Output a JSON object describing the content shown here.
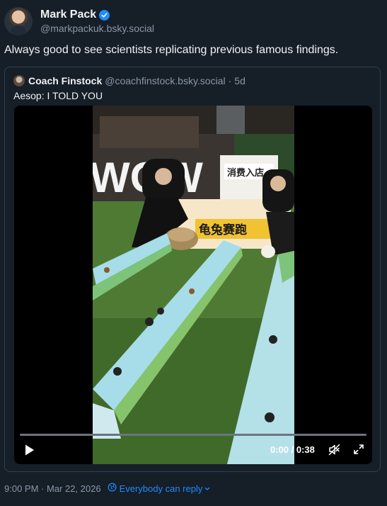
{
  "post": {
    "author_name": "Mark Pack",
    "author_handle": "@markpackuk.bsky.social",
    "text": "Always good to see scientists replicating previous famous findings.",
    "timestamp": "9:00 PM · Mar 22, 2026",
    "reply_setting": "Everybody can reply"
  },
  "quote": {
    "author_name": "Coach Finstock",
    "author_handle": "@coachfinstock.bsky.social",
    "separator": "·",
    "age": "5d",
    "text": "Aesop: I TOLD YOU"
  },
  "video": {
    "time_display": "0:00 / 0:38",
    "progress": 0,
    "scene_sign_text": "消费入店",
    "scene_banner_text": "龟兔赛跑",
    "scene_big_letters": "WOW"
  },
  "colors": {
    "background": "#161e27",
    "accent": "#208bfe",
    "muted_text": "#8a98a8",
    "border": "#2e4052"
  },
  "icons": {
    "verified": "verified-badge-icon",
    "play": "play-icon",
    "mute": "mute-icon",
    "fullscreen": "fullscreen-icon",
    "globe": "globe-icon",
    "chevron": "chevron-down-icon"
  }
}
